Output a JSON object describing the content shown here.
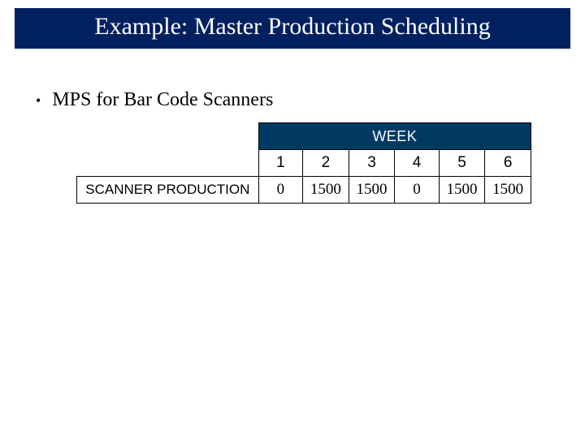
{
  "title": "Example:  Master Production Scheduling",
  "bullet": "MPS for Bar Code Scanners",
  "table": {
    "header": "WEEK",
    "weeks": [
      "1",
      "2",
      "3",
      "4",
      "5",
      "6"
    ],
    "row_label": "SCANNER PRODUCTION",
    "values": [
      "0",
      "1500",
      "1500",
      "0",
      "1500",
      "1500"
    ]
  },
  "chart_data": {
    "type": "table",
    "title": "MPS for Bar Code Scanners",
    "columns": [
      "Week 1",
      "Week 2",
      "Week 3",
      "Week 4",
      "Week 5",
      "Week 6"
    ],
    "series": [
      {
        "name": "SCANNER PRODUCTION",
        "values": [
          0,
          1500,
          1500,
          0,
          1500,
          1500
        ]
      }
    ]
  }
}
